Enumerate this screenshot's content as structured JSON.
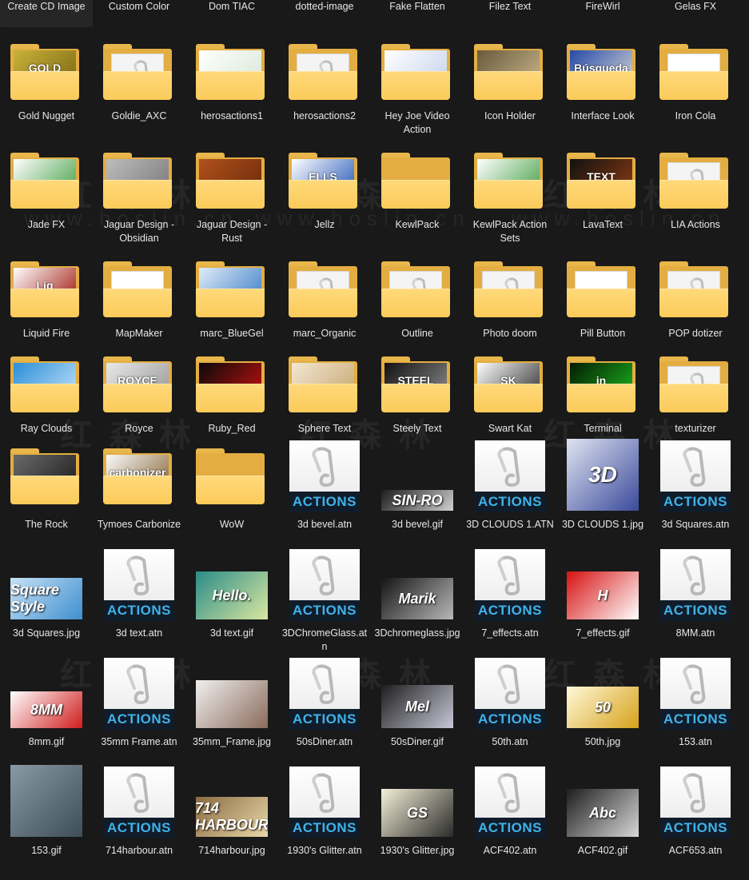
{
  "watermark": {
    "cn": "红森林",
    "url": "www.hoslin.cn"
  },
  "items": [
    {
      "label": "Create CD Image",
      "kind": "none",
      "c1": "#000"
    },
    {
      "label": "Custom Color",
      "kind": "none",
      "c1": "#000"
    },
    {
      "label": "Dom TIAC",
      "kind": "none",
      "c1": "#000"
    },
    {
      "label": "dotted-image",
      "kind": "none",
      "c1": "#000"
    },
    {
      "label": "Fake Flatten",
      "kind": "none",
      "c1": "#000"
    },
    {
      "label": "Filez Text",
      "kind": "none",
      "c1": "#000"
    },
    {
      "label": "FireWirl",
      "kind": "none",
      "c1": "#000"
    },
    {
      "label": "Gelas FX",
      "kind": "none",
      "c1": "#000"
    },
    {
      "label": "Gold Nugget",
      "kind": "folder",
      "p": "img",
      "c1": "#c9b23a",
      "c2": "#7d6a14",
      "pt": "GOLD"
    },
    {
      "label": "Goldie_AXC",
      "kind": "folder",
      "p": "doc"
    },
    {
      "label": "herosactions1",
      "kind": "folder",
      "p": "img",
      "c1": "#ffffff",
      "c2": "#d8e8d8",
      "pt": ""
    },
    {
      "label": "herosactions2",
      "kind": "folder",
      "p": "doc"
    },
    {
      "label": "Hey Joe Video Action",
      "kind": "folder",
      "p": "img",
      "c1": "#ffffff",
      "c2": "#c7d4ee",
      "pt": ""
    },
    {
      "label": "Icon Holder",
      "kind": "folder",
      "p": "img",
      "c1": "#6a5a3c",
      "c2": "#c7b48a",
      "pt": ""
    },
    {
      "label": "Interface Look",
      "kind": "folder",
      "p": "img",
      "c1": "#2549a8",
      "c2": "#d3d3d3",
      "pt": "Búsqueda"
    },
    {
      "label": "Iron Cola",
      "kind": "folder",
      "p": "page"
    },
    {
      "label": "Jade FX",
      "kind": "folder",
      "p": "img",
      "c1": "#ffffff",
      "c2": "#4aa14a",
      "pt": ""
    },
    {
      "label": "Jaguar Design - Obsidian",
      "kind": "folder",
      "p": "img",
      "c1": "#bdbdbd",
      "c2": "#7a7a7a",
      "pt": ""
    },
    {
      "label": "Jaguar Design - Rust",
      "kind": "folder",
      "p": "img",
      "c1": "#b0521c",
      "c2": "#6e2a0a",
      "pt": ""
    },
    {
      "label": "Jellz",
      "kind": "folder",
      "p": "img",
      "c1": "#ffffff",
      "c2": "#2a5cb8",
      "pt": "ELLS"
    },
    {
      "label": "KewlPack",
      "kind": "folder",
      "p": "empty"
    },
    {
      "label": "KewlPack Action Sets",
      "kind": "folder",
      "p": "img",
      "c1": "#ffffff",
      "c2": "#4aa14a",
      "pt": ""
    },
    {
      "label": "LavaText",
      "kind": "folder",
      "p": "img",
      "c1": "#111111",
      "c2": "#8a3a12",
      "pt": "TEXT"
    },
    {
      "label": "LIA Actions",
      "kind": "folder",
      "p": "doc"
    },
    {
      "label": "Liquid Fire",
      "kind": "folder",
      "p": "img",
      "c1": "#ffffff",
      "c2": "#a01c12",
      "pt": "Liq"
    },
    {
      "label": "MapMaker",
      "kind": "folder",
      "p": "page"
    },
    {
      "label": "marc_BlueGel",
      "kind": "folder",
      "p": "img",
      "c1": "#e0ecf8",
      "c2": "#3e7fc8",
      "pt": ""
    },
    {
      "label": "marc_Organic",
      "kind": "folder",
      "p": "doc"
    },
    {
      "label": "Outline",
      "kind": "folder",
      "p": "doc"
    },
    {
      "label": "Photo doom",
      "kind": "folder",
      "p": "doc"
    },
    {
      "label": "Pill Button",
      "kind": "folder",
      "p": "page"
    },
    {
      "label": "POP dotizer",
      "kind": "folder",
      "p": "doc"
    },
    {
      "label": "Ray Clouds",
      "kind": "folder",
      "p": "img",
      "c1": "#2b8ed8",
      "c2": "#bfe0f8",
      "pt": ""
    },
    {
      "label": "Royce",
      "kind": "folder",
      "p": "img",
      "c1": "#e8e8e8",
      "c2": "#9a9a9a",
      "pt": "ROYCE"
    },
    {
      "label": "Ruby_Red",
      "kind": "folder",
      "p": "img",
      "c1": "#0a0a0a",
      "c2": "#c01010",
      "pt": ""
    },
    {
      "label": "Sphere Text",
      "kind": "folder",
      "p": "img",
      "c1": "#f2e6d2",
      "c2": "#c9a872",
      "pt": ""
    },
    {
      "label": "Steely Text",
      "kind": "folder",
      "p": "img",
      "c1": "#111111",
      "c2": "#8a8a8a",
      "pt": "STEEL"
    },
    {
      "label": "Swart Kat",
      "kind": "folder",
      "p": "img",
      "c1": "#ffffff",
      "c2": "#333333",
      "pt": "SK"
    },
    {
      "label": "Terminal",
      "kind": "folder",
      "p": "img",
      "c1": "#041a04",
      "c2": "#1bb31b",
      "pt": "in"
    },
    {
      "label": "texturizer",
      "kind": "folder",
      "p": "doc"
    },
    {
      "label": "The Rock",
      "kind": "folder",
      "p": "img",
      "c1": "#6a6a6a",
      "c2": "#1e1e1e",
      "pt": ""
    },
    {
      "label": "Tymoes Carbonize",
      "kind": "folder",
      "p": "img",
      "c1": "#fafafa",
      "c2": "#8a6a3a",
      "pt": "carbonizer"
    },
    {
      "label": "WoW",
      "kind": "folder",
      "p": "empty"
    },
    {
      "label": "3d bevel.atn",
      "kind": "atn"
    },
    {
      "label": "3d bevel.gif",
      "kind": "img",
      "c1": "#1d1d1d",
      "c2": "#d0d0d0",
      "pt": "SIN-RO",
      "h": 26
    },
    {
      "label": "3D CLOUDS 1.ATN",
      "kind": "atn"
    },
    {
      "label": "3D CLOUDS 1.jpg",
      "kind": "img",
      "c1": "#dfe4f2",
      "c2": "#3a4a9a",
      "pt": "3D",
      "h": 90
    },
    {
      "label": "3d Squares.atn",
      "kind": "atn"
    },
    {
      "label": "3d Squares.jpg",
      "kind": "img",
      "c1": "#c7e2f4",
      "c2": "#3f8fd0",
      "pt": "Square Style",
      "h": 52
    },
    {
      "label": "3d text.atn",
      "kind": "atn"
    },
    {
      "label": "3d text.gif",
      "kind": "img",
      "c1": "#2a8c88",
      "c2": "#d9e7a0",
      "pt": "Hello.",
      "h": 60
    },
    {
      "label": "3DChromeGlass.atn",
      "kind": "atn"
    },
    {
      "label": "3Dchromeglass.jpg",
      "kind": "img",
      "c1": "#141414",
      "c2": "#b8b8b8",
      "pt": "Marik",
      "h": 52
    },
    {
      "label": "7_effects.atn",
      "kind": "atn"
    },
    {
      "label": "7_effects.gif",
      "kind": "img",
      "c1": "#d61010",
      "c2": "#ffffff",
      "pt": "H",
      "h": 60
    },
    {
      "label": "8MM.atn",
      "kind": "atn"
    },
    {
      "label": "8mm.gif",
      "kind": "img",
      "c1": "#ffffff",
      "c2": "#d01c1c",
      "pt": "8MM",
      "h": 46
    },
    {
      "label": "35mm Frame.atn",
      "kind": "atn"
    },
    {
      "label": "35mm_Frame.jpg",
      "kind": "img",
      "c1": "#f0f0f0",
      "c2": "#8a6a5a",
      "pt": "",
      "h": 60
    },
    {
      "label": "50sDiner.atn",
      "kind": "atn"
    },
    {
      "label": "50sDiner.gif",
      "kind": "img",
      "c1": "#1d1d1d",
      "c2": "#c8c8d8",
      "pt": "Mel",
      "h": 54
    },
    {
      "label": "50th.atn",
      "kind": "atn"
    },
    {
      "label": "50th.jpg",
      "kind": "img",
      "c1": "#fff8d8",
      "c2": "#d6a21a",
      "pt": "50",
      "h": 52
    },
    {
      "label": "153.atn",
      "kind": "atn"
    },
    {
      "label": "153.gif",
      "kind": "img",
      "c1": "#8a9aa4",
      "c2": "#3e4e58",
      "pt": "",
      "h": 90
    },
    {
      "label": "714harbour.atn",
      "kind": "atn"
    },
    {
      "label": "714harbour.jpg",
      "kind": "img",
      "c1": "#8a6a42",
      "c2": "#e8d8a8",
      "pt": "714 HARBOUR",
      "h": 50
    },
    {
      "label": "1930's Glitter.atn",
      "kind": "atn"
    },
    {
      "label": "1930's Glitter.jpg",
      "kind": "img",
      "c1": "#f4f0d8",
      "c2": "#2a2a2a",
      "pt": "GS",
      "h": 60
    },
    {
      "label": "ACF402.atn",
      "kind": "atn"
    },
    {
      "label": "ACF402.gif",
      "kind": "img",
      "c1": "#1d1d1d",
      "c2": "#d8d8d8",
      "pt": "Abc",
      "h": 60
    },
    {
      "label": "ACF653.atn",
      "kind": "atn"
    }
  ],
  "actions_text": "ACTIONS"
}
